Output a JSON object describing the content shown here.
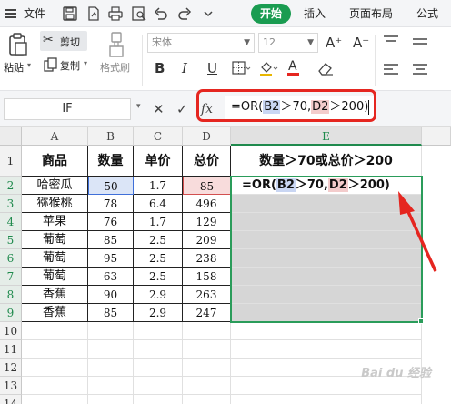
{
  "menu": {
    "file": "文件",
    "start": "开始",
    "insert": "插入",
    "page_layout": "页面布局",
    "formulas": "公式"
  },
  "ribbon": {
    "cut": "剪切",
    "paste": "粘贴",
    "copy": "复制",
    "format_painter": "格式刷",
    "font_name": "宋体",
    "font_size": "12",
    "grow_font": "A⁺",
    "shrink_font": "A⁻",
    "bold": "B",
    "italic": "I",
    "underline": "U",
    "font_color": "A"
  },
  "formula_bar": {
    "name_box": "IF",
    "cancel": "✕",
    "confirm": "✓",
    "fx": "fx",
    "formula_prefix": "=OR(",
    "ref_b": "B2",
    "formula_mid": "＞70,",
    "ref_d": "D2",
    "formula_suffix": "＞200)"
  },
  "columns": [
    "A",
    "B",
    "C",
    "D",
    "E"
  ],
  "rows": [
    "1",
    "2",
    "3",
    "4",
    "5",
    "6",
    "7",
    "8",
    "9",
    "10",
    "11",
    "12",
    "13",
    "14"
  ],
  "headers": {
    "a": "商品",
    "b": "数量",
    "c": "单价",
    "d": "总价",
    "e": "数量＞70或总价＞200"
  },
  "table_rows": [
    {
      "a": "哈密瓜",
      "b": "50",
      "c": "1.7",
      "d": "85"
    },
    {
      "a": "猕猴桃",
      "b": "78",
      "c": "6.4",
      "d": "496"
    },
    {
      "a": "苹果",
      "b": "76",
      "c": "1.7",
      "d": "129"
    },
    {
      "a": "葡萄",
      "b": "85",
      "c": "2.5",
      "d": "209"
    },
    {
      "a": "葡萄",
      "b": "95",
      "c": "2.5",
      "d": "238"
    },
    {
      "a": "葡萄",
      "b": "63",
      "c": "2.5",
      "d": "158"
    },
    {
      "a": "香蕉",
      "b": "90",
      "c": "2.9",
      "d": "263"
    },
    {
      "a": "香蕉",
      "b": "85",
      "c": "2.9",
      "d": "247"
    }
  ],
  "editing_cell": {
    "prefix": "=OR(",
    "ref_b": "B2",
    "mid": "＞70,",
    "ref_d": "D2",
    "suffix": "＞200)"
  },
  "watermark": "Bai du 经验",
  "colors": {
    "accent_green": "#1a9c51",
    "annotation_red": "#e52620",
    "ref_blue": "#3f6fd8",
    "ref_red": "#d24f4f",
    "selection_fill": "#d6d6d6"
  }
}
